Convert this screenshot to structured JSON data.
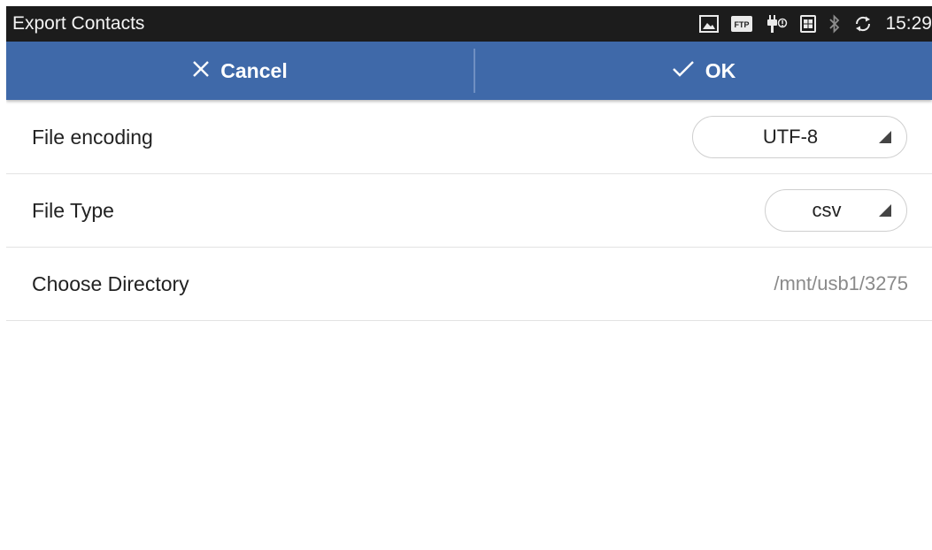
{
  "statusbar": {
    "title": "Export Contacts",
    "time": "15:29",
    "icons": [
      "image-icon",
      "ftp-icon",
      "usb-icon",
      "sim-card-icon",
      "bluetooth-icon",
      "sync-icon"
    ],
    "ftp_label": "FTP"
  },
  "actionbar": {
    "cancel_label": "Cancel",
    "cancel_icon": "close-icon",
    "ok_label": "OK",
    "ok_icon": "check-icon",
    "color": "#3f69a9"
  },
  "settings": {
    "file_encoding": {
      "label": "File encoding",
      "value": "UTF-8"
    },
    "file_type": {
      "label": "File Type",
      "value": "csv"
    },
    "directory": {
      "label": "Choose Directory",
      "value": "/mnt/usb1/3275"
    }
  }
}
